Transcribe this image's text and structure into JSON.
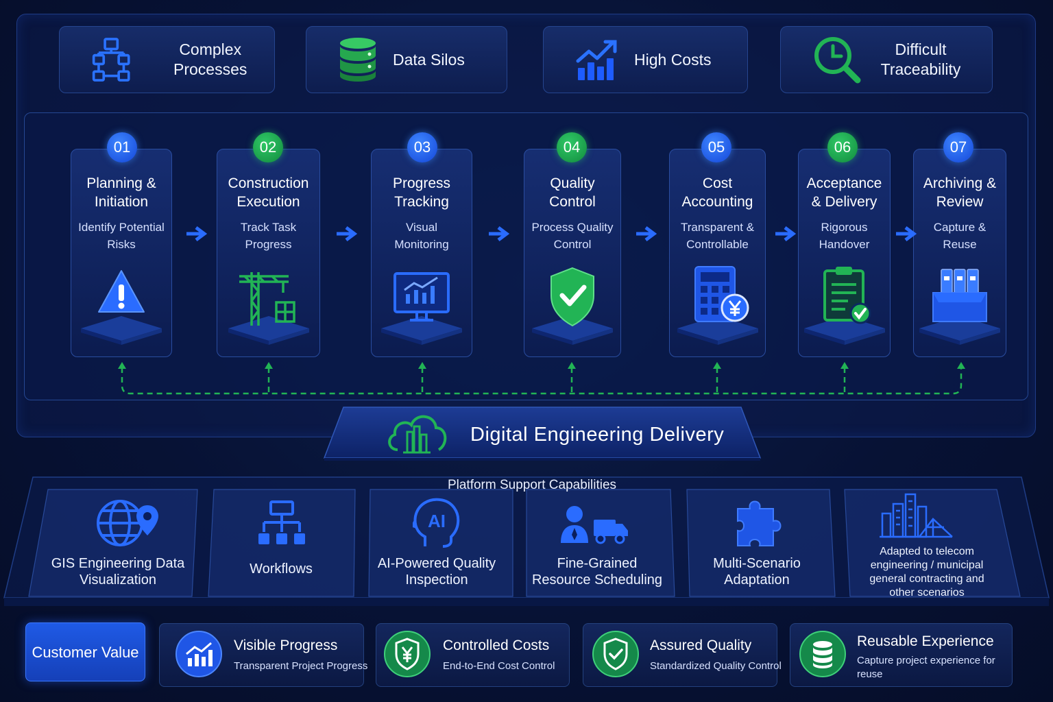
{
  "pain_points": [
    {
      "label": "Complex Processes",
      "icon": "flowchart-icon"
    },
    {
      "label": "Data Silos",
      "icon": "database-icon"
    },
    {
      "label": "High Costs",
      "icon": "rising-chart-icon"
    },
    {
      "label": "Difficult Traceability",
      "icon": "clock-magnifier-icon"
    }
  ],
  "steps": [
    {
      "number": "01",
      "title": "Planning & Initiation",
      "subtitle": "Identify Potential Risks",
      "icon": "warning-icon",
      "color": "blue"
    },
    {
      "number": "02",
      "title": "Construction Execution",
      "subtitle": "Track Task Progress",
      "icon": "crane-icon",
      "color": "green"
    },
    {
      "number": "03",
      "title": "Progress Tracking",
      "subtitle": "Visual Monitoring",
      "icon": "monitor-chart-icon",
      "color": "blue"
    },
    {
      "number": "04",
      "title": "Quality Control",
      "subtitle": "Process Quality Control",
      "icon": "shield-check-icon",
      "color": "green"
    },
    {
      "number": "05",
      "title": "Cost Accounting",
      "subtitle": "Transparent & Controllable",
      "icon": "calculator-yen-icon",
      "color": "blue"
    },
    {
      "number": "06",
      "title": "Acceptance & Delivery",
      "subtitle": "Rigorous Handover",
      "icon": "clipboard-check-icon",
      "color": "green"
    },
    {
      "number": "07",
      "title": "Archiving & Review",
      "subtitle": "Capture & Reuse",
      "icon": "archive-binders-icon",
      "color": "blue"
    }
  ],
  "center": {
    "title": "Digital Engineering Delivery",
    "icon": "cloud-city-icon"
  },
  "platform": {
    "title": "Platform Support Capabilities",
    "capabilities": [
      {
        "label": "GIS Engineering Data Visualization",
        "icon": "globe-pin-icon"
      },
      {
        "label": "Workflows",
        "icon": "workflow-icon"
      },
      {
        "label": "AI-Powered Quality Inspection",
        "icon": "ai-head-icon"
      },
      {
        "label": "Fine-Grained Resource Scheduling",
        "icon": "person-truck-icon"
      },
      {
        "label": "Multi-Scenario Adaptation",
        "icon": "puzzle-icon"
      },
      {
        "label": "Adapted to telecom engineering / municipal general contracting and other scenarios",
        "icon": "city-skyline-icon"
      }
    ]
  },
  "customer_value": {
    "label": "Customer Value",
    "items": [
      {
        "title": "Visible Progress",
        "subtitle": "Transparent Project Progress",
        "icon": "bar-chart-icon",
        "color": "blue"
      },
      {
        "title": "Controlled Costs",
        "subtitle": "End-to-End Cost Control",
        "icon": "yen-shield-icon",
        "color": "green"
      },
      {
        "title": "Assured Quality",
        "subtitle": "Standardized Quality Control",
        "icon": "shield-check-icon",
        "color": "green"
      },
      {
        "title": "Reusable Experience",
        "subtitle": "Capture project experience for reuse",
        "icon": "database-icon",
        "color": "green"
      }
    ]
  },
  "colors": {
    "accent_blue": "#1e5cff",
    "accent_green": "#22b455",
    "background": "#071235"
  }
}
